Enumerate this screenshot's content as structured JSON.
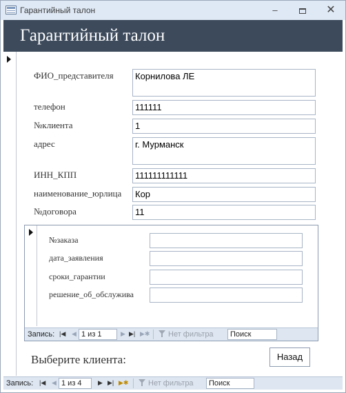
{
  "window": {
    "title": "Гарантийный талон",
    "icons": {
      "app": "table-icon",
      "minimize": "minimize-icon",
      "maximize": "maximize-icon",
      "close": "close-icon"
    },
    "min_glyph": "–",
    "close_glyph": "✕"
  },
  "form": {
    "heading": "Гарантийный талон",
    "fields": [
      {
        "label": "ФИО_представителя",
        "value": "Корнилова ЛЕ"
      },
      {
        "label": "телефон",
        "value": "111111"
      },
      {
        "label": "№клиента",
        "value": "1"
      },
      {
        "label": "адрес",
        "value": "г. Мурманск"
      },
      {
        "label": "ИНН_КПП",
        "value": "111111111111"
      },
      {
        "label": "наименование_юрлица",
        "value": "Кор"
      },
      {
        "label": "№договора",
        "value": "11"
      }
    ]
  },
  "subform": {
    "fields": [
      {
        "label": "№заказа",
        "value": ""
      },
      {
        "label": "дата_заявления",
        "value": ""
      },
      {
        "label": "сроки_гарантии",
        "value": ""
      },
      {
        "label": "решение_об_обслужива",
        "value": ""
      }
    ],
    "nav": {
      "label": "Запись:",
      "position": "1 из 1",
      "filter": "Нет фильтра",
      "search": "Поиск"
    }
  },
  "footer": {
    "choose_label": "Выберите клиента:",
    "back_button": "Назад"
  },
  "nav": {
    "label": "Запись:",
    "position": "1 из 4",
    "filter": "Нет фильтра",
    "search": "Поиск"
  },
  "nav_glyphs": {
    "first": "|◀",
    "prev": "◀",
    "next": "▶",
    "last": "▶|",
    "new": "▶✱"
  },
  "colors": {
    "header_bg": "#3c4a5c",
    "titlebar_bg": "#dfe9f5",
    "navbar_bg": "#dde6f1"
  }
}
